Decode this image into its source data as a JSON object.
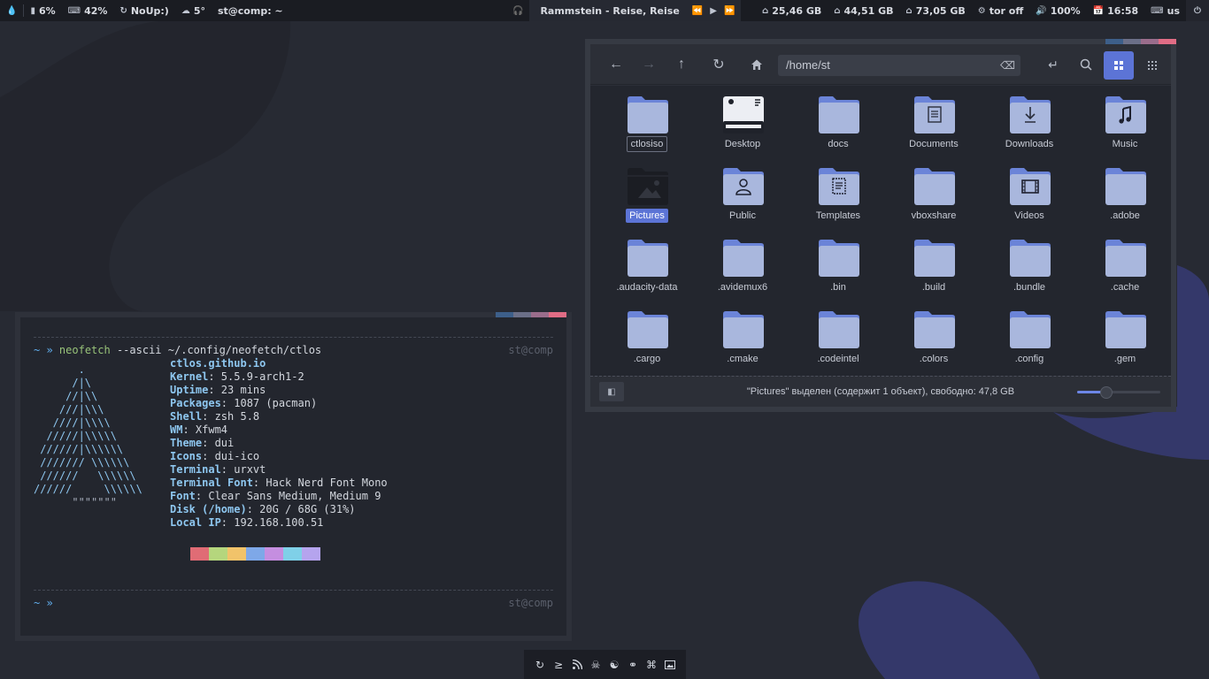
{
  "topbar": {
    "left": [
      {
        "icon": "drop-icon",
        "text": ""
      },
      {
        "icon": "memory-icon",
        "text": "6%"
      },
      {
        "icon": "keyboard-icon",
        "text": "42%"
      },
      {
        "icon": "refresh-icon",
        "text": "NoUp:)"
      },
      {
        "icon": "cloud-icon",
        "text": "5°"
      },
      {
        "icon": "",
        "text": "st@comp: ~"
      }
    ],
    "music": {
      "title": "Rammstein - Reise, Reise"
    },
    "right": [
      {
        "icon": "disk-icon",
        "text": "25,46 GB"
      },
      {
        "icon": "disk-icon",
        "text": "44,51 GB"
      },
      {
        "icon": "disk-icon",
        "text": "73,05 GB"
      },
      {
        "icon": "gear-icon",
        "text": "tor off"
      },
      {
        "icon": "volume-icon",
        "text": "100%"
      },
      {
        "icon": "calendar-icon",
        "text": "16:58"
      },
      {
        "icon": "keyboard-icon",
        "text": "us"
      },
      {
        "icon": "power-icon",
        "text": ""
      }
    ]
  },
  "terminal": {
    "prompt": "~ »",
    "command": "neofetch",
    "args": "--ascii",
    "path": "~/.config/neofetch/ctlos",
    "host_right": "st@comp",
    "title": "ctlos.github.io",
    "info": [
      {
        "label": "Kernel",
        "value": ": 5.5.9-arch1-2"
      },
      {
        "label": "Uptime",
        "value": ": 23 mins"
      },
      {
        "label": "Packages",
        "value": ": 1087 (pacman)"
      },
      {
        "label": "Shell",
        "value": ": zsh 5.8"
      },
      {
        "label": "WM",
        "value": ": Xfwm4"
      },
      {
        "label": "Theme",
        "value": ": dui"
      },
      {
        "label": "Icons",
        "value": ": dui-ico"
      },
      {
        "label": "Terminal",
        "value": ": urxvt"
      },
      {
        "label": "Terminal Font",
        "value": ": Hack Nerd Font Mono"
      },
      {
        "label": "Font",
        "value": ": Clear Sans Medium, Medium 9"
      },
      {
        "label": "Disk (/home)",
        "value": ": 20G / 68G (31%)"
      },
      {
        "label": "Local IP",
        "value": ": 192.168.100.51"
      }
    ],
    "ascii_lines": [
      "       .",
      "      /|\\",
      "     //|\\\\",
      "    ///|\\\\\\",
      "   ////|\\\\\\\\",
      "  /////|\\\\\\\\\\",
      " //////|\\\\\\\\\\\\",
      " /////// \\\\\\\\\\\\",
      " //////   \\\\\\\\\\\\",
      "//////     \\\\\\\\\\\\",
      "      \"\"\"\"\"\"\""
    ],
    "palette": [
      "#23262e",
      "#e06c75",
      "#b5d67d",
      "#f1c36a",
      "#7ea8e8",
      "#c58ee0",
      "#7fd0e8",
      "#b5a4ee"
    ],
    "prompt2": "~ »",
    "host_right2": "st@comp"
  },
  "files": {
    "path": "/home/st",
    "items": [
      {
        "name": "ctlosiso",
        "glyph": ""
      },
      {
        "name": "Desktop",
        "glyph": "desktop"
      },
      {
        "name": "docs",
        "glyph": ""
      },
      {
        "name": "Documents",
        "glyph": "doc"
      },
      {
        "name": "Downloads",
        "glyph": "down"
      },
      {
        "name": "Music",
        "glyph": "music"
      },
      {
        "name": "Pictures",
        "glyph": "pic"
      },
      {
        "name": "Public",
        "glyph": "user"
      },
      {
        "name": "Templates",
        "glyph": "tpl"
      },
      {
        "name": "vboxshare",
        "glyph": ""
      },
      {
        "name": "Videos",
        "glyph": "film"
      },
      {
        "name": ".adobe",
        "glyph": ""
      },
      {
        "name": ".audacity-data",
        "glyph": ""
      },
      {
        "name": ".avidemux6",
        "glyph": ""
      },
      {
        "name": ".bin",
        "glyph": ""
      },
      {
        "name": ".build",
        "glyph": ""
      },
      {
        "name": ".bundle",
        "glyph": ""
      },
      {
        "name": ".cache",
        "glyph": ""
      },
      {
        "name": ".cargo",
        "glyph": ""
      },
      {
        "name": ".cmake",
        "glyph": ""
      },
      {
        "name": ".codeintel",
        "glyph": ""
      },
      {
        "name": ".colors",
        "glyph": ""
      },
      {
        "name": ".config",
        "glyph": ""
      },
      {
        "name": ".gem",
        "glyph": ""
      }
    ],
    "selected": "Pictures",
    "focused": "ctlosiso",
    "status": "\"Pictures\" выделен (содержит 1 объект), свободно: 47,8 GB",
    "zoom_level": 0.35
  },
  "dock": {
    "icons": [
      "refresh-icon",
      "terminal-icon",
      "rss-icon",
      "skull-icon",
      "yin-yang-icon",
      "link-icon",
      "crop-icon",
      "image-icon"
    ]
  },
  "colors": {
    "accent_blue": "#5c74d6",
    "accent_strip": [
      "#3d5f8a",
      "#6b6f88",
      "#9a6d8c",
      "#e06c85"
    ],
    "folder": "#a9b7dd",
    "folder_tab": "#6b84d8"
  }
}
